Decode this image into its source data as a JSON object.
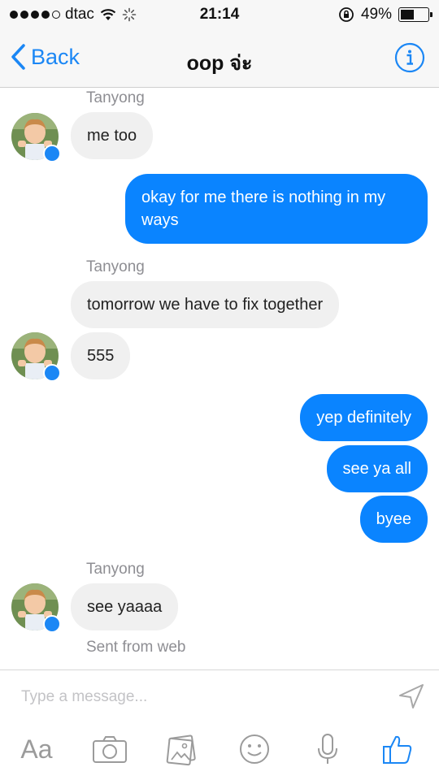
{
  "status_bar": {
    "carrier": "dtac",
    "time": "21:14",
    "battery": "49%"
  },
  "nav": {
    "back_label": "Back",
    "title": "oop จ่ะ"
  },
  "messages": [
    {
      "sender": "Tanyong",
      "text": "me too",
      "direction": "incoming"
    },
    {
      "text": "okay for me there is nothing in my ways",
      "direction": "outgoing"
    },
    {
      "sender": "Tanyong",
      "text": "tomorrow we have to fix together",
      "direction": "incoming"
    },
    {
      "text": "555",
      "direction": "incoming"
    },
    {
      "text": "yep definitely",
      "direction": "outgoing"
    },
    {
      "text": "see ya all",
      "direction": "outgoing"
    },
    {
      "text": "byee",
      "direction": "outgoing"
    },
    {
      "sender": "Tanyong",
      "text": "see yaaaa",
      "direction": "incoming"
    }
  ],
  "meta": {
    "sent_from": "Sent from web"
  },
  "composer": {
    "placeholder": "Type a message...",
    "aa_label": "Aa"
  },
  "colors": {
    "accent": "#1b87f5",
    "outgoing_bubble": "#0a84ff",
    "incoming_bubble": "#f0f0f0"
  },
  "icons": [
    "back-chevron-icon",
    "info-icon",
    "messenger-badge-icon",
    "send-icon",
    "camera-icon",
    "photos-icon",
    "emoji-icon",
    "microphone-icon",
    "like-icon",
    "wifi-icon",
    "loading-icon",
    "rotation-lock-icon",
    "battery-icon"
  ]
}
